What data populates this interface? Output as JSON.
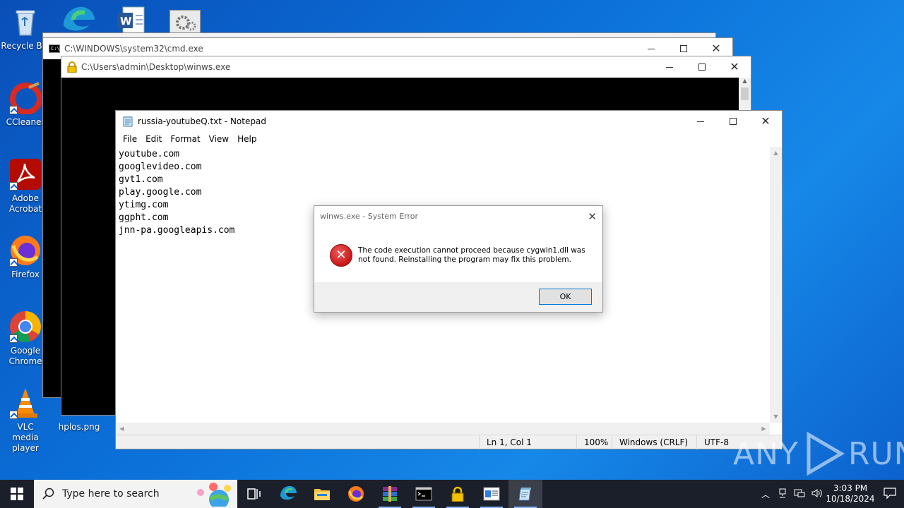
{
  "desktop": {
    "icons": [
      {
        "label": "Recycle Bin"
      },
      {
        "label": "CCleaner"
      },
      {
        "label": "Adobe Acrobat"
      },
      {
        "label": "Firefox"
      },
      {
        "label": "Google Chrome"
      },
      {
        "label": "VLC media player"
      },
      {
        "label": "hplos.png"
      }
    ]
  },
  "cmd_window": {
    "title": "C:\\WINDOWS\\system32\\cmd.exe"
  },
  "winws_window": {
    "title": "C:\\Users\\admin\\Desktop\\winws.exe"
  },
  "notepad": {
    "title": "russia-youtubeQ.txt - Notepad",
    "menu": [
      "File",
      "Edit",
      "Format",
      "View",
      "Help"
    ],
    "lines": [
      "youtube.com",
      "googlevideo.com",
      "gvt1.com",
      "play.google.com",
      "ytimg.com",
      "ggpht.com",
      "jnn-pa.googleapis.com"
    ],
    "status": {
      "position": "Ln 1, Col 1",
      "zoom": "100%",
      "line_ending": "Windows (CRLF)",
      "encoding": "UTF-8"
    }
  },
  "dialog": {
    "title": "winws.exe - System Error",
    "message": "The code execution cannot proceed because cygwin1.dll was not found. Reinstalling the program may fix this problem.",
    "ok_label": "OK"
  },
  "taskbar": {
    "search_placeholder": "Type here to search",
    "time": "3:03 PM",
    "date": "10/18/2024"
  },
  "watermark": {
    "left": "ANY",
    "right": "RUN"
  },
  "colors": {
    "accent": "#0078d7",
    "error": "#c71717",
    "taskbar": "#1b1f2a"
  }
}
